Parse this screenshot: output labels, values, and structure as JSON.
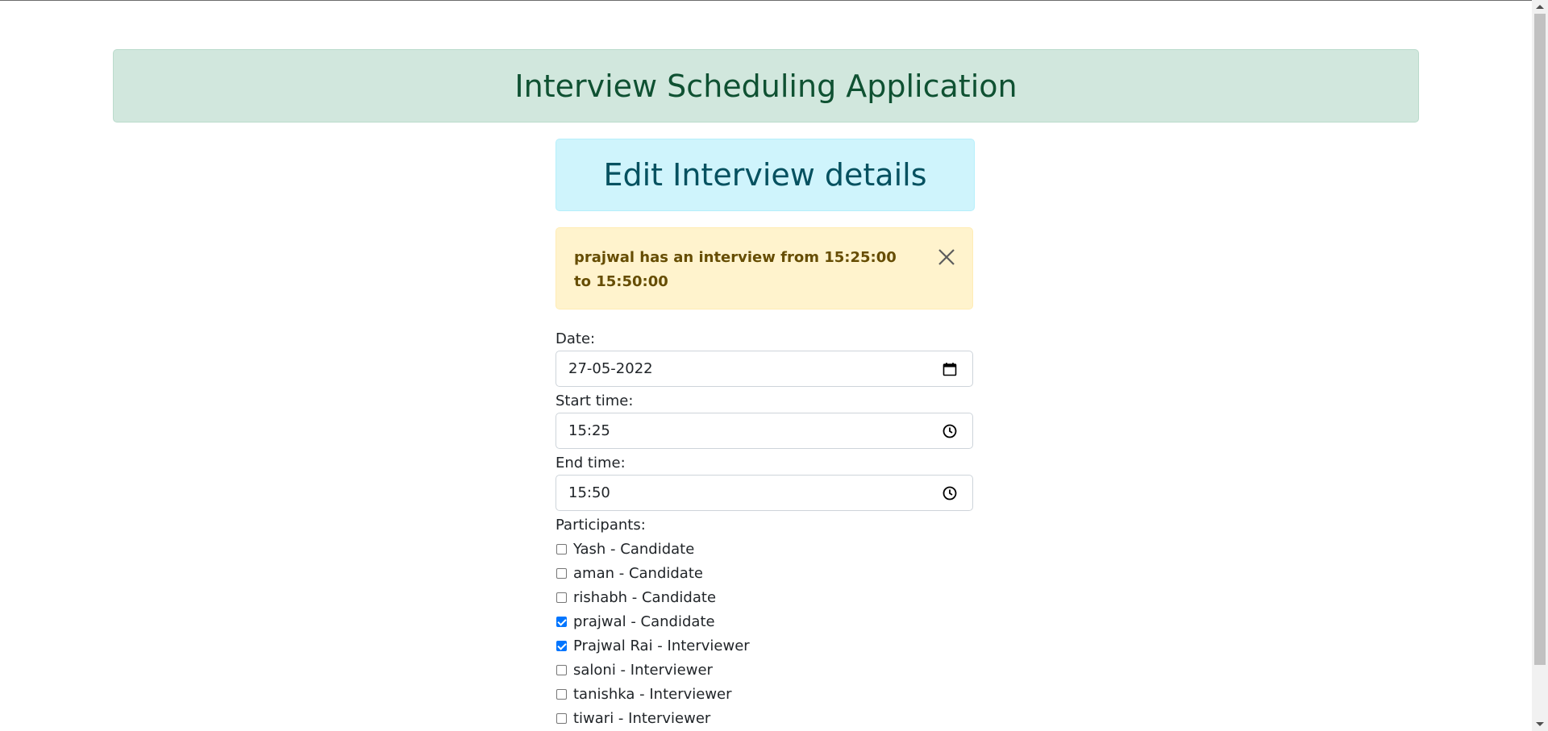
{
  "app": {
    "title": "Interview Scheduling Application"
  },
  "page": {
    "heading": "Edit Interview details"
  },
  "alert": {
    "message": "prajwal has an interview from 15:25:00 to 15:50:00",
    "close_icon": "close-icon"
  },
  "form": {
    "date_label": "Date:",
    "date_value": "27-05-2022",
    "date_icon": "calendar-icon",
    "start_label": "Start time:",
    "start_value": "15:25",
    "start_icon": "clock-icon",
    "end_label": "End time:",
    "end_value": "15:50",
    "end_icon": "clock-icon",
    "participants_label": "Participants:",
    "participants": [
      {
        "label": "Yash - Candidate",
        "checked": false
      },
      {
        "label": "aman - Candidate",
        "checked": false
      },
      {
        "label": "rishabh - Candidate",
        "checked": false
      },
      {
        "label": "prajwal - Candidate",
        "checked": true
      },
      {
        "label": "Prajwal Rai - Interviewer",
        "checked": true
      },
      {
        "label": "saloni - Interviewer",
        "checked": false
      },
      {
        "label": "tanishka - Interviewer",
        "checked": false
      },
      {
        "label": "tiwari - Interviewer",
        "checked": false
      }
    ]
  },
  "colors": {
    "success_bg": "#d1e7dd",
    "success_text": "#0f5132",
    "info_bg": "#cff4fc",
    "info_text": "#055160",
    "warning_bg": "#fff3cd",
    "warning_text": "#664d03",
    "checkbox_checked": "#0075ff"
  }
}
